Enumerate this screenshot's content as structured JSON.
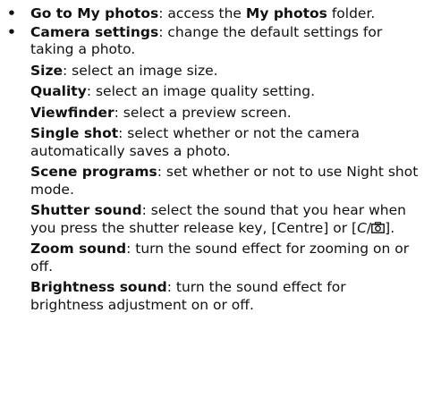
{
  "items": [
    {
      "title": "Go to My photos",
      "text_a": ": access the ",
      "title_b": "My photos",
      "text_b": " folder."
    },
    {
      "title": "Camera settings",
      "text": ": change the default settings for taking a photo.",
      "subs": [
        {
          "title": "Size",
          "text": ": select an image size."
        },
        {
          "title": "Quality",
          "text": ": select an image quality setting."
        },
        {
          "title": "Viewfinder",
          "text": ": select a preview screen."
        },
        {
          "title": "Single shot",
          "text": ": select whether or not the camera automatically saves a photo."
        },
        {
          "title": "Scene programs",
          "text": ": set whether or not to use Night shot mode."
        },
        {
          "title": "Shutter sound",
          "text": ": select the sound that you hear when you press the shutter release key, [Centre] or [",
          "key_letter": "C",
          "key_sep": "/",
          "text_end": "]."
        },
        {
          "title": "Zoom sound",
          "text": ": turn the sound effect for zooming on or off."
        },
        {
          "title": "Brightness sound",
          "text": ": turn the sound effect for brightness adjustment on or off."
        }
      ]
    }
  ],
  "bullet_glyph": "•",
  "icons": {
    "camera_key": "camera-icon"
  }
}
